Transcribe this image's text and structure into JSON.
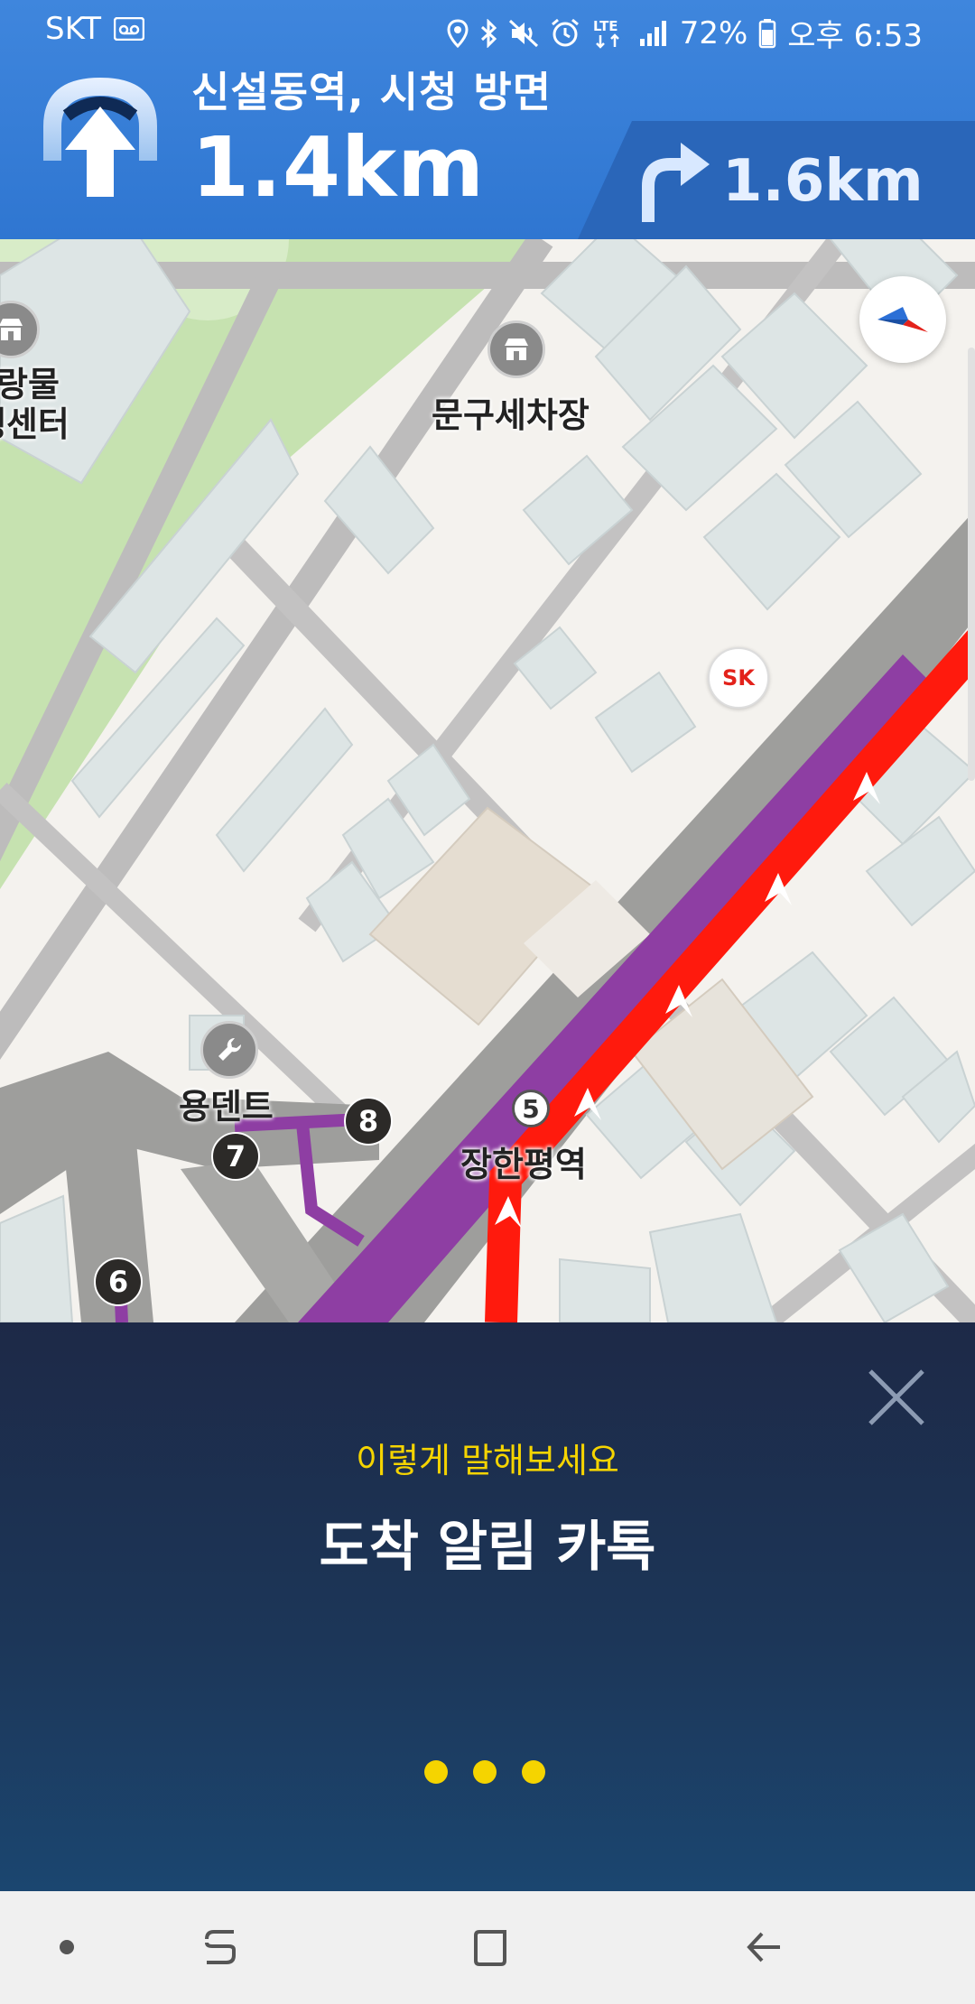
{
  "status_bar": {
    "carrier": "SKT",
    "battery": "72%",
    "time": "오후 6:53",
    "network": "LTE",
    "icons": [
      "voicemail-icon",
      "location-icon",
      "bluetooth-icon",
      "mute-icon",
      "alarm-icon",
      "lte-icon",
      "signal-icon",
      "battery-icon"
    ]
  },
  "navigation": {
    "street": "신설동역, 시청 방면",
    "distance": "1.4km",
    "main_maneuver_icon": "straight-tunnel-icon",
    "next_turn": {
      "distance": "1.6km",
      "icon": "turn-right-icon"
    }
  },
  "map": {
    "labels": {
      "left_poi_line1": "랑물",
      "left_poi_line2": "생센터",
      "car_wash": "문구세차장",
      "repair_shop": "용덴트",
      "station": "장한평역"
    },
    "brand_badge": "SK",
    "waypoints": [
      "5",
      "6",
      "7",
      "8"
    ],
    "route_colors": {
      "route": "#ff1a0d",
      "subway_line": "#8e3ea3"
    }
  },
  "voice_panel": {
    "hint": "이렇게 말해보세요",
    "command": "도착 알림 카톡",
    "state": "listening",
    "accent_color": "#f5d400"
  },
  "system_nav": {
    "buttons": [
      "dot-indicator",
      "recent-apps-icon",
      "home-icon",
      "back-icon"
    ]
  }
}
